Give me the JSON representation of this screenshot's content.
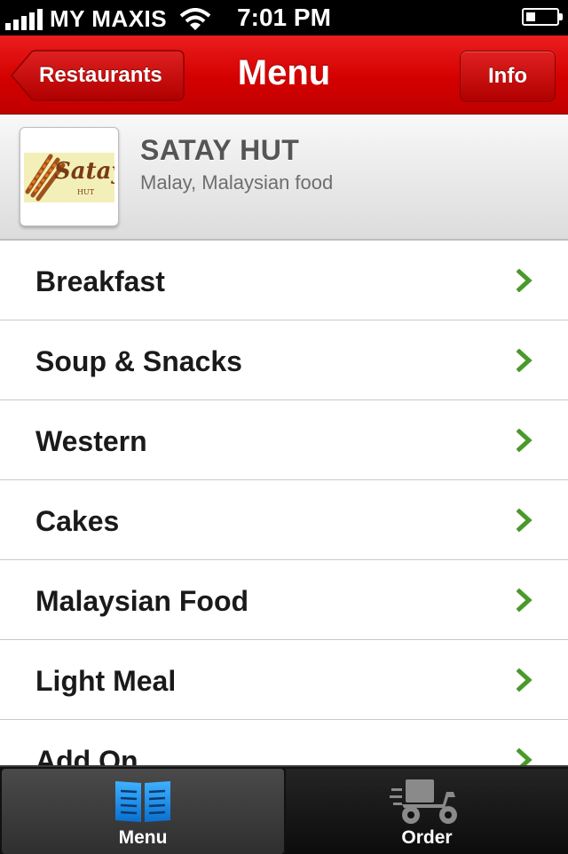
{
  "status_bar": {
    "carrier": "MY MAXIS",
    "time": "7:01 PM",
    "battery_level": 0.3
  },
  "nav": {
    "back_label": "Restaurants",
    "title": "Menu",
    "info_label": "Info"
  },
  "restaurant": {
    "name": "SATAY HUT",
    "cuisine": "Malay, Malaysian food",
    "logo_text": "Satay",
    "logo_subtext": "HUT"
  },
  "menu_items": [
    {
      "label": "Breakfast"
    },
    {
      "label": "Soup & Snacks"
    },
    {
      "label": "Western"
    },
    {
      "label": "Cakes"
    },
    {
      "label": "Malaysian Food"
    },
    {
      "label": "Light Meal"
    },
    {
      "label": "Add On"
    }
  ],
  "tabs": [
    {
      "label": "Menu",
      "icon": "menu-book-icon",
      "selected": true
    },
    {
      "label": "Order",
      "icon": "delivery-scooter-icon",
      "selected": false
    }
  ],
  "colors": {
    "navbar": "#d40000",
    "chevron": "#4a9a2a",
    "menu_tab_icon": "#1e90e8"
  }
}
